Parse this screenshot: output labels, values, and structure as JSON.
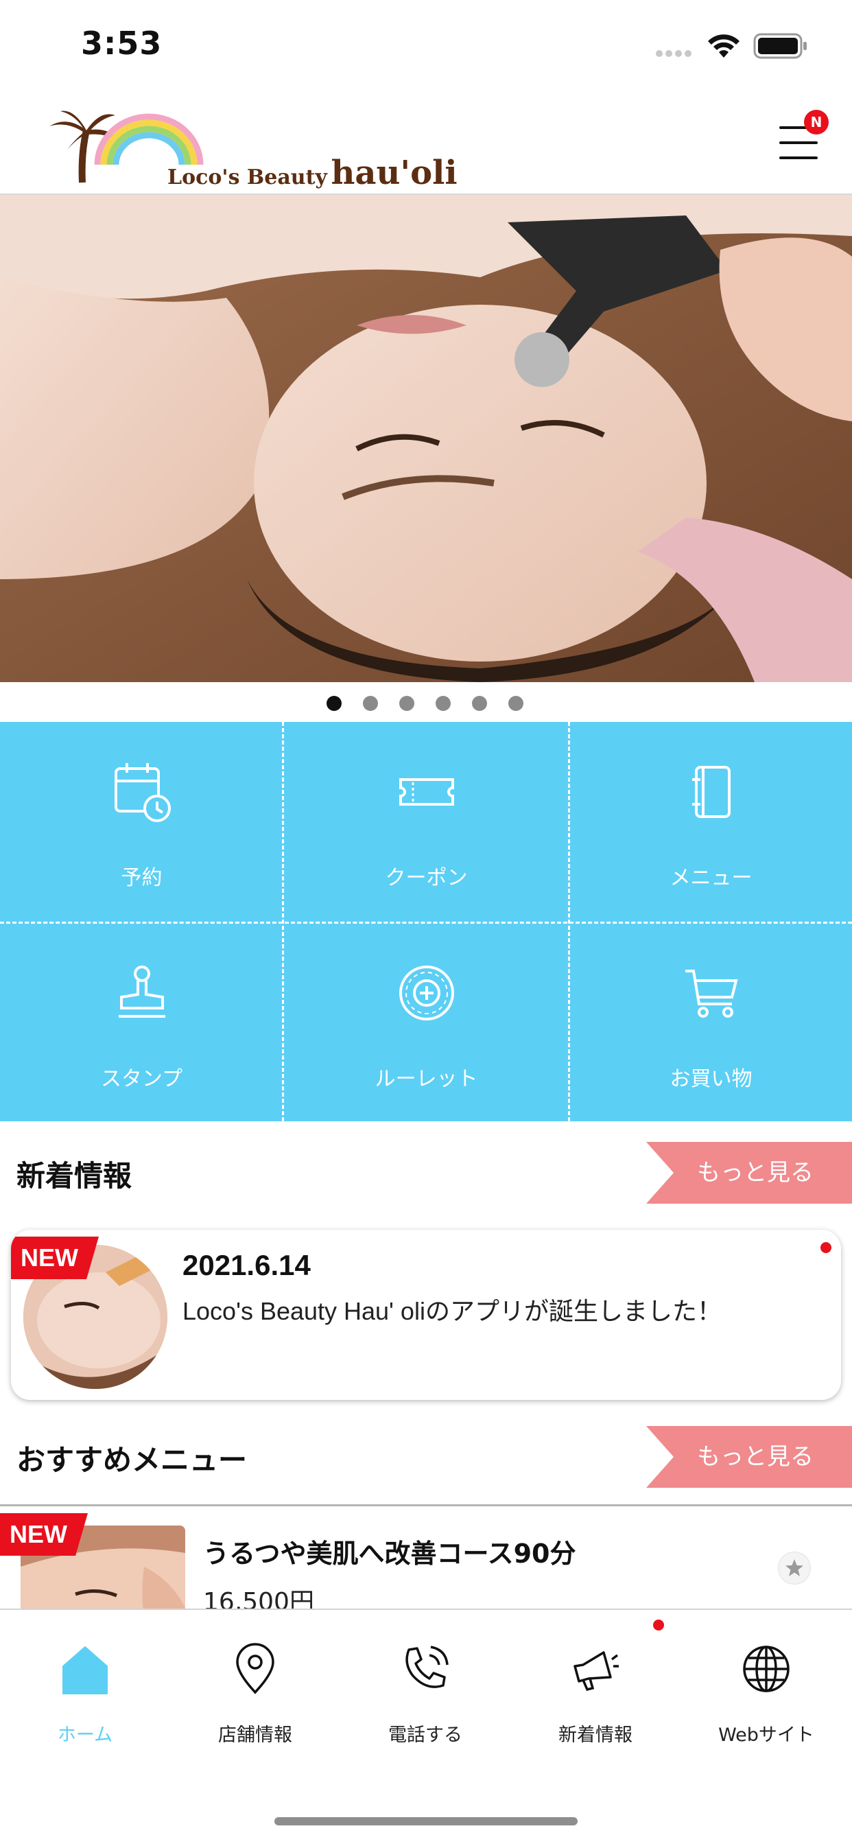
{
  "status": {
    "time": "3:53"
  },
  "header": {
    "logo_small": "Loco's Beauty",
    "logo_big": "hau'oli",
    "notification_badge": "N"
  },
  "carousel": {
    "pages": 6,
    "active": 0
  },
  "grid": [
    {
      "label": "予約",
      "icon": "calendar-clock-icon"
    },
    {
      "label": "クーポン",
      "icon": "ticket-icon"
    },
    {
      "label": "メニュー",
      "icon": "book-icon"
    },
    {
      "label": "スタンプ",
      "icon": "stamp-icon"
    },
    {
      "label": "ルーレット",
      "icon": "roulette-icon"
    },
    {
      "label": "お買い物",
      "icon": "cart-icon"
    }
  ],
  "news": {
    "title": "新着情報",
    "more": "もっと見る",
    "item": {
      "tag": "NEW",
      "date": "2021.6.14",
      "text": "Loco's Beauty Hau' oliのアプリが誕生しました！"
    }
  },
  "recommended": {
    "title": "おすすめメニュー",
    "more": "もっと見る",
    "item": {
      "tag": "NEW",
      "name": "うるつや美肌へ改善コース90分",
      "price": "16,500円"
    }
  },
  "tabbar": [
    {
      "label": "ホーム",
      "icon": "home-icon",
      "active": true
    },
    {
      "label": "店舗情報",
      "icon": "location-pin-icon"
    },
    {
      "label": "電話する",
      "icon": "phone-icon"
    },
    {
      "label": "新着情報",
      "icon": "megaphone-icon"
    },
    {
      "label": "Webサイト",
      "icon": "globe-icon"
    }
  ],
  "colors": {
    "accent": "#5ccff5",
    "more_button": "#f08a8d",
    "new_tag": "#e8101c",
    "logo_brown": "#5b2d12"
  }
}
